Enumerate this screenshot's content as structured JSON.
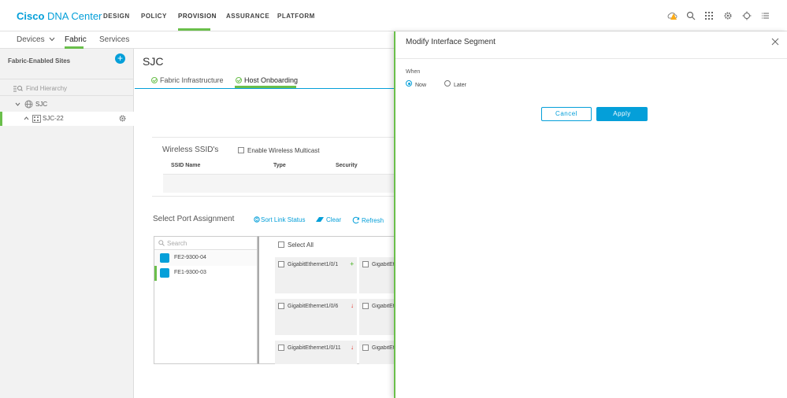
{
  "app": {
    "brand_bold": "Cisco",
    "brand_light": " DNA Center"
  },
  "topnav": {
    "items": [
      "DESIGN",
      "POLICY",
      "PROVISION",
      "ASSURANCE",
      "PLATFORM"
    ],
    "active": "PROVISION",
    "icons": [
      "alert-icon",
      "search-icon",
      "apps-grid-icon",
      "gear-icon",
      "crosshair-icon",
      "list-icon"
    ]
  },
  "subnav": {
    "items": [
      "Devices",
      "Fabric",
      "Services"
    ],
    "active": "Fabric"
  },
  "sidebar": {
    "title": "Fabric-Enabled Sites",
    "search_placeholder": "Find Hierarchy",
    "tree": [
      {
        "label": "SJC"
      },
      {
        "label": "SJC-22"
      }
    ]
  },
  "main": {
    "title": "SJC",
    "tabs": [
      "Fabric Infrastructure",
      "Host Onboarding"
    ],
    "active_tab": "Host Onboarding",
    "wireless": {
      "title": "Wireless SSID's",
      "multicast_label": "Enable Wireless Multicast",
      "columns": [
        "SSID Name",
        "Type",
        "Security"
      ]
    },
    "ports": {
      "title": "Select Port Assignment",
      "actions": [
        "Sort Link Status",
        "Clear",
        "Refresh"
      ],
      "search_placeholder": "Search",
      "devices": [
        "FE2-9300-04",
        "FE1-9300-03"
      ],
      "select_all": "Select All",
      "cards": [
        {
          "name": "GigabitEthernet1/0/1",
          "status": "up"
        },
        {
          "name": "GigabitEth",
          "status": ""
        },
        {
          "name": "GigabitEthernet1/0/6",
          "status": "down"
        },
        {
          "name": "GigabitEth",
          "status": ""
        },
        {
          "name": "GigabitEthernet1/0/11",
          "status": "down"
        },
        {
          "name": "GigabitEth",
          "status": ""
        }
      ]
    }
  },
  "modal": {
    "title": "Modify Interface Segment",
    "when_label": "When",
    "options": [
      "Now",
      "Later"
    ],
    "selected": "Now",
    "cancel_label": "Cancel",
    "apply_label": "Apply"
  },
  "colors": {
    "accent": "#049fd9",
    "active": "#6abf4b",
    "down": "#e2231a",
    "warn": "#fbab18"
  }
}
